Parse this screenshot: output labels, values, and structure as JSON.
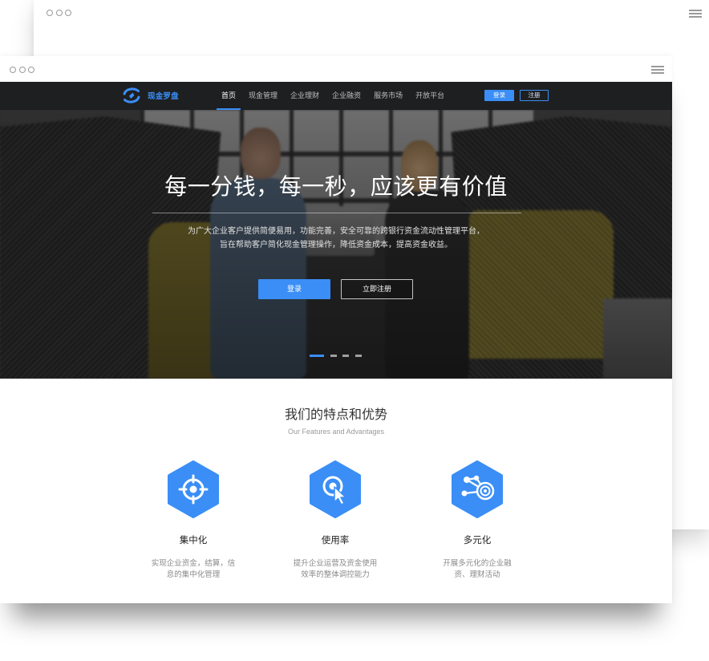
{
  "colors": {
    "accent": "#3a8ef6",
    "nav_background": "#1e1f21",
    "window_chrome": "#9a9a9a",
    "hexagon": "#3a8ef6"
  },
  "back_window": {
    "controls_icon": "window-dots-icon",
    "menu_icon": "hamburger-menu-icon"
  },
  "front_window": {
    "controls_icon": "window-dots-icon",
    "menu_icon": "hamburger-menu-icon"
  },
  "navbar": {
    "logo_icon": "compass-logo-icon",
    "brand": "现金罗盘",
    "items": [
      {
        "label": "首页",
        "active": true
      },
      {
        "label": "现金管理",
        "active": false
      },
      {
        "label": "企业理财",
        "active": false
      },
      {
        "label": "企业融资",
        "active": false
      },
      {
        "label": "服务市场",
        "active": false
      },
      {
        "label": "开放平台",
        "active": false
      }
    ],
    "login_label": "登录",
    "register_label": "注册"
  },
  "hero": {
    "title": "每一分钱，每一秒，应该更有价值",
    "subtitle_lines": [
      "为广大企业客户提供简便易用，功能完善，安全可靠的跨银行资金流动性管理平台，",
      "旨在帮助客户简化现金管理操作，降低资金成本，提高资金收益。"
    ],
    "primary_button": "登录",
    "secondary_button": "立即注册",
    "carousel": {
      "slide_count": 4,
      "active_slide": 0
    }
  },
  "features": {
    "title": "我们的特点和优势",
    "subtitle": "Our Features and Advantages",
    "items": [
      {
        "icon": "target-icon",
        "title": "集中化",
        "description_lines": [
          "实现企业资金，结算，信",
          "息的集中化管理"
        ]
      },
      {
        "icon": "click-pointer-icon",
        "title": "使用率",
        "description_lines": [
          "提升企业运营及资金使用",
          "效率的整体调控能力"
        ]
      },
      {
        "icon": "network-nodes-icon",
        "title": "多元化",
        "description_lines": [
          "开展多元化的企业融",
          "资、理财活动"
        ]
      }
    ]
  }
}
